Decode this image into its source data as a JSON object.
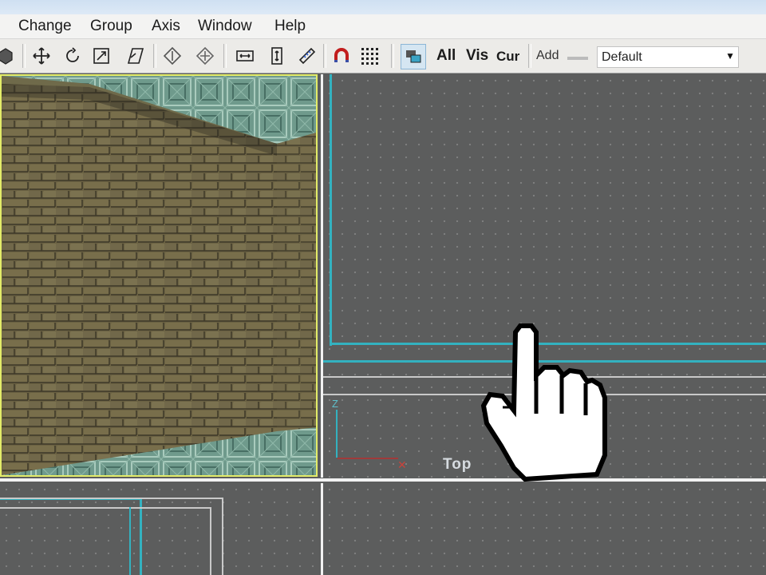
{
  "menu": [
    "Change",
    "Group",
    "Axis",
    "Window",
    "Help"
  ],
  "toolbar": {
    "icons": [
      "shape-icon",
      "move-icon",
      "rotate-icon",
      "scale-icon",
      "shear-icon",
      "erase-icon",
      "target-icon",
      "width-icon",
      "height-icon",
      "ruler-icon",
      "magnet-icon",
      "grid-icon",
      "visgroup-icon"
    ],
    "visibility": {
      "all": "All",
      "vis": "Vis",
      "cur": "Cur"
    },
    "add_label": "Add",
    "group_dropdown": {
      "value": "Default"
    }
  },
  "viewports": {
    "top_label": "Top",
    "axis_z": "Z"
  },
  "colors": {
    "selection_cyan": "#33b2c0",
    "active_border": "#e3ec68",
    "viewport_bg": "#5c5d5d"
  }
}
